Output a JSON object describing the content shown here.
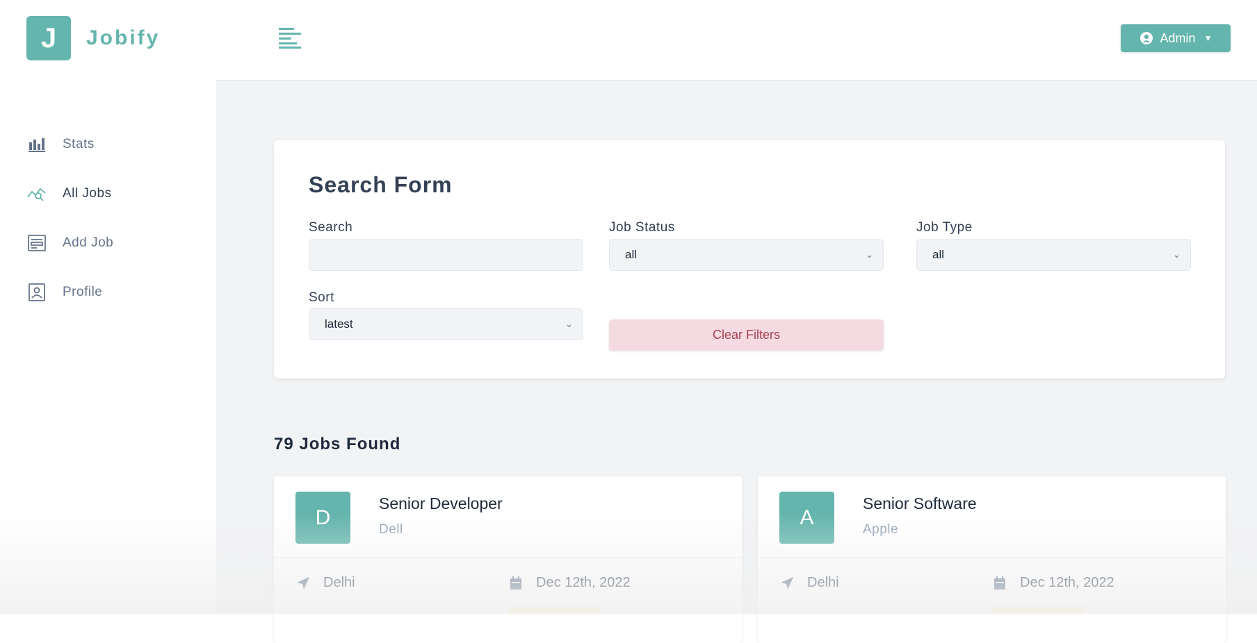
{
  "brand": {
    "logo_letter": "J",
    "name": "Jobify",
    "accent": "#64b5ad"
  },
  "sidebar": {
    "items": [
      {
        "label": "Stats",
        "icon": "bar-chart-icon",
        "active": false
      },
      {
        "label": "All Jobs",
        "icon": "query-stats-icon",
        "active": true
      },
      {
        "label": "Add Job",
        "icon": "form-icon",
        "active": false
      },
      {
        "label": "Profile",
        "icon": "profile-id-icon",
        "active": false
      }
    ]
  },
  "topbar": {
    "user_label": "Admin"
  },
  "search_form": {
    "title": "Search Form",
    "search": {
      "label": "Search",
      "value": ""
    },
    "job_status": {
      "label": "Job Status",
      "value": "all"
    },
    "job_type": {
      "label": "Job Type",
      "value": "all"
    },
    "sort": {
      "label": "Sort",
      "value": "latest"
    },
    "clear_label": "Clear Filters"
  },
  "results": {
    "count_text": "79 Jobs Found"
  },
  "jobs": [
    {
      "letter": "D",
      "position": "Senior Developer",
      "company": "Dell",
      "location": "Delhi",
      "date": "Dec 12th, 2022"
    },
    {
      "letter": "A",
      "position": "Senior Software",
      "company": "Apple",
      "location": "Delhi",
      "date": "Dec 12th, 2022"
    }
  ]
}
